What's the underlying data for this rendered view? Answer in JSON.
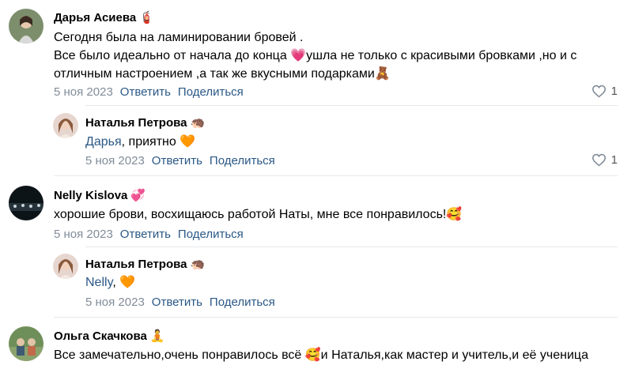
{
  "comments": [
    {
      "author": "Дарья Асиева",
      "badge": "🧯",
      "text_lines": [
        "Сегодня была на ламинировании бровей .",
        "Все было идеально от начала до конца 💗ушла не только с красивыми бровками ,но и с",
        "отличным настроением ,а так же вкусными подарками🧸"
      ],
      "date": "5 ноя 2023",
      "reply_label": "Ответить",
      "share_label": "Поделиться",
      "likes": "1",
      "reply": {
        "author": "Наталья Петрова",
        "badge": "🦔",
        "mention": "Дарья",
        "text": ", приятно 🧡",
        "date": "5 ноя 2023",
        "reply_label": "Ответить",
        "share_label": "Поделиться",
        "likes": "1"
      }
    },
    {
      "author": "Nelly Kislova",
      "badge": "💞",
      "text_lines": [
        "хорошие брови, восхищаюсь работой Наты, мне все понравилось!🥰"
      ],
      "date": "5 ноя 2023",
      "reply_label": "Ответить",
      "share_label": "Поделиться",
      "reply": {
        "author": "Наталья Петрова",
        "badge": "🦔",
        "mention": "Nelly",
        "text": ", 🧡",
        "date": "5 ноя 2023",
        "reply_label": "Ответить",
        "share_label": "Поделиться"
      }
    },
    {
      "author": "Ольга Скачкова",
      "badge": "🧘",
      "text_lines": [
        "Все замечательно,очень понравилось всё 🥰и Наталья,как мастер и учитель,и её ученица"
      ]
    }
  ],
  "colors": {
    "link": "#2a5885",
    "meta": "#818c99",
    "divider": "#e7e8ec"
  }
}
